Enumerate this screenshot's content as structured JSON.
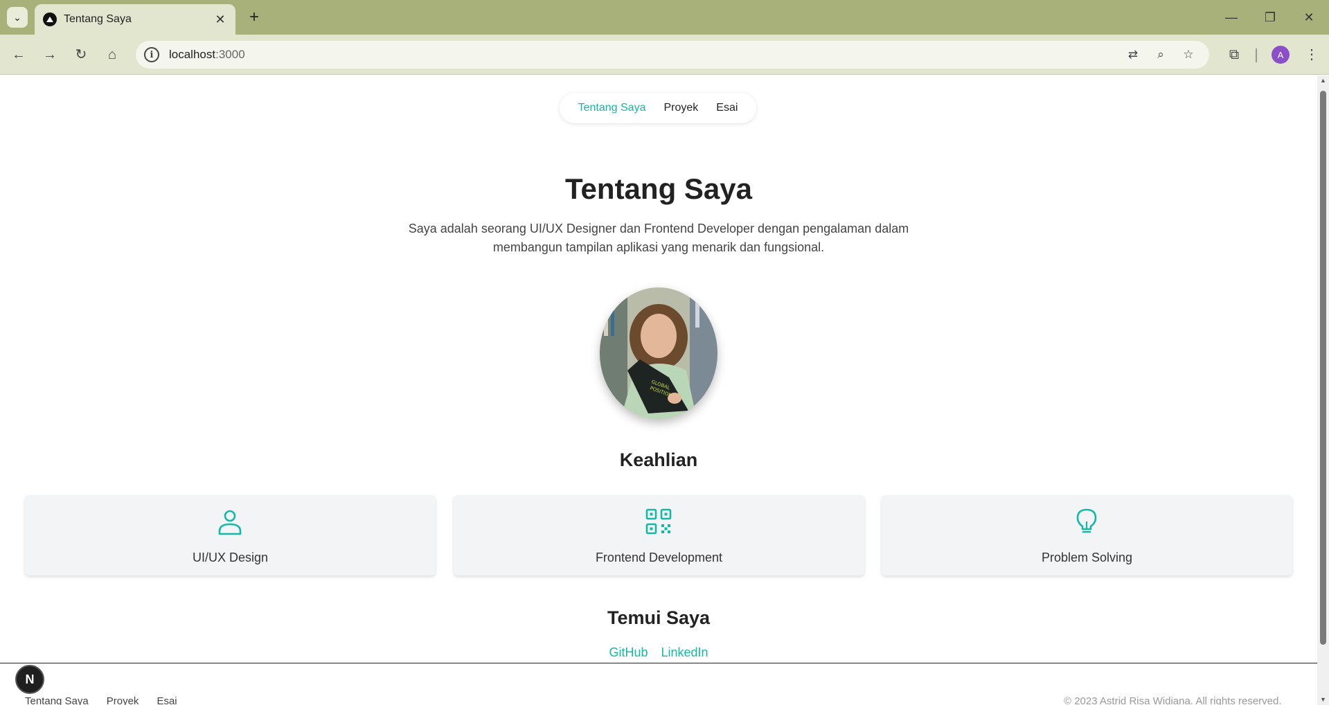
{
  "browser": {
    "tab_title": "Tentang Saya",
    "url_host": "localhost",
    "url_port": ":3000",
    "profile_initial": "A"
  },
  "nav": {
    "items": [
      {
        "label": "Tentang Saya",
        "active": true
      },
      {
        "label": "Proyek",
        "active": false
      },
      {
        "label": "Esai",
        "active": false
      }
    ]
  },
  "hero": {
    "title": "Tentang Saya",
    "description": "Saya adalah seorang UI/UX Designer dan Frontend Developer dengan pengalaman dalam membangun tampilan aplikasi yang menarik dan fungsional."
  },
  "skills": {
    "title": "Keahlian",
    "items": [
      {
        "label": "UI/UX Design",
        "icon": "user-icon"
      },
      {
        "label": "Frontend Development",
        "icon": "qr-code-icon"
      },
      {
        "label": "Problem Solving",
        "icon": "lightbulb-icon"
      }
    ]
  },
  "meet": {
    "title": "Temui Saya",
    "links": [
      "GitHub",
      "LinkedIn"
    ]
  },
  "footer": {
    "links": [
      "Tentang Saya",
      "Proyek",
      "Esai"
    ],
    "copyright": "© 2023 Astrid Risa Widiana. All rights reserved."
  },
  "dev_badge": "N",
  "colors": {
    "accent": "#14b8a6",
    "chrome": "#a9b17a"
  }
}
